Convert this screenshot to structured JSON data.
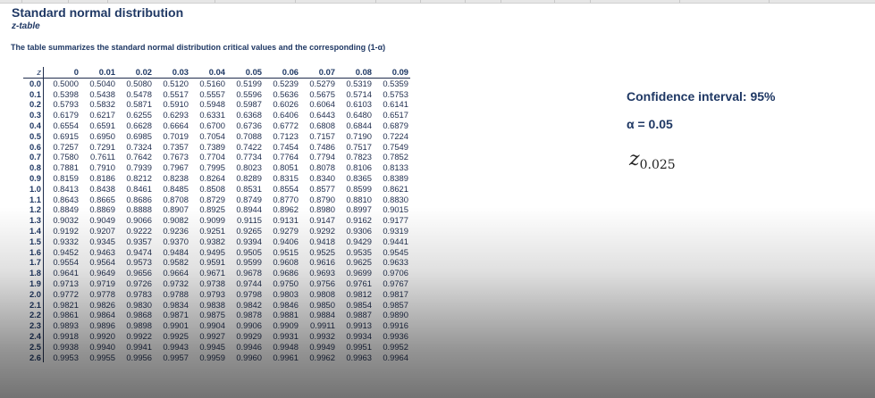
{
  "header": {
    "title": "Standard normal distribution",
    "subtitle": "z-table",
    "description": "The table summarizes the standard normal distribution critical values and the corresponding (1-α)"
  },
  "table": {
    "corner": "z",
    "columns": [
      "0",
      "0.01",
      "0.02",
      "0.03",
      "0.04",
      "0.05",
      "0.06",
      "0.07",
      "0.08",
      "0.09"
    ],
    "rows": [
      {
        "z": "0.0",
        "values": [
          "0.5000",
          "0.5040",
          "0.5080",
          "0.5120",
          "0.5160",
          "0.5199",
          "0.5239",
          "0.5279",
          "0.5319",
          "0.5359"
        ]
      },
      {
        "z": "0.1",
        "values": [
          "0.5398",
          "0.5438",
          "0.5478",
          "0.5517",
          "0.5557",
          "0.5596",
          "0.5636",
          "0.5675",
          "0.5714",
          "0.5753"
        ]
      },
      {
        "z": "0.2",
        "values": [
          "0.5793",
          "0.5832",
          "0.5871",
          "0.5910",
          "0.5948",
          "0.5987",
          "0.6026",
          "0.6064",
          "0.6103",
          "0.6141"
        ]
      },
      {
        "z": "0.3",
        "values": [
          "0.6179",
          "0.6217",
          "0.6255",
          "0.6293",
          "0.6331",
          "0.6368",
          "0.6406",
          "0.6443",
          "0.6480",
          "0.6517"
        ]
      },
      {
        "z": "0.4",
        "values": [
          "0.6554",
          "0.6591",
          "0.6628",
          "0.6664",
          "0.6700",
          "0.6736",
          "0.6772",
          "0.6808",
          "0.6844",
          "0.6879"
        ]
      },
      {
        "z": "0.5",
        "values": [
          "0.6915",
          "0.6950",
          "0.6985",
          "0.7019",
          "0.7054",
          "0.7088",
          "0.7123",
          "0.7157",
          "0.7190",
          "0.7224"
        ]
      },
      {
        "z": "0.6",
        "values": [
          "0.7257",
          "0.7291",
          "0.7324",
          "0.7357",
          "0.7389",
          "0.7422",
          "0.7454",
          "0.7486",
          "0.7517",
          "0.7549"
        ]
      },
      {
        "z": "0.7",
        "values": [
          "0.7580",
          "0.7611",
          "0.7642",
          "0.7673",
          "0.7704",
          "0.7734",
          "0.7764",
          "0.7794",
          "0.7823",
          "0.7852"
        ]
      },
      {
        "z": "0.8",
        "values": [
          "0.7881",
          "0.7910",
          "0.7939",
          "0.7967",
          "0.7995",
          "0.8023",
          "0.8051",
          "0.8078",
          "0.8106",
          "0.8133"
        ]
      },
      {
        "z": "0.9",
        "values": [
          "0.8159",
          "0.8186",
          "0.8212",
          "0.8238",
          "0.8264",
          "0.8289",
          "0.8315",
          "0.8340",
          "0.8365",
          "0.8389"
        ]
      },
      {
        "z": "1.0",
        "values": [
          "0.8413",
          "0.8438",
          "0.8461",
          "0.8485",
          "0.8508",
          "0.8531",
          "0.8554",
          "0.8577",
          "0.8599",
          "0.8621"
        ]
      },
      {
        "z": "1.1",
        "values": [
          "0.8643",
          "0.8665",
          "0.8686",
          "0.8708",
          "0.8729",
          "0.8749",
          "0.8770",
          "0.8790",
          "0.8810",
          "0.8830"
        ]
      },
      {
        "z": "1.2",
        "values": [
          "0.8849",
          "0.8869",
          "0.8888",
          "0.8907",
          "0.8925",
          "0.8944",
          "0.8962",
          "0.8980",
          "0.8997",
          "0.9015"
        ]
      },
      {
        "z": "1.3",
        "values": [
          "0.9032",
          "0.9049",
          "0.9066",
          "0.9082",
          "0.9099",
          "0.9115",
          "0.9131",
          "0.9147",
          "0.9162",
          "0.9177"
        ]
      },
      {
        "z": "1.4",
        "values": [
          "0.9192",
          "0.9207",
          "0.9222",
          "0.9236",
          "0.9251",
          "0.9265",
          "0.9279",
          "0.9292",
          "0.9306",
          "0.9319"
        ]
      },
      {
        "z": "1.5",
        "values": [
          "0.9332",
          "0.9345",
          "0.9357",
          "0.9370",
          "0.9382",
          "0.9394",
          "0.9406",
          "0.9418",
          "0.9429",
          "0.9441"
        ]
      },
      {
        "z": "1.6",
        "values": [
          "0.9452",
          "0.9463",
          "0.9474",
          "0.9484",
          "0.9495",
          "0.9505",
          "0.9515",
          "0.9525",
          "0.9535",
          "0.9545"
        ]
      },
      {
        "z": "1.7",
        "values": [
          "0.9554",
          "0.9564",
          "0.9573",
          "0.9582",
          "0.9591",
          "0.9599",
          "0.9608",
          "0.9616",
          "0.9625",
          "0.9633"
        ]
      },
      {
        "z": "1.8",
        "values": [
          "0.9641",
          "0.9649",
          "0.9656",
          "0.9664",
          "0.9671",
          "0.9678",
          "0.9686",
          "0.9693",
          "0.9699",
          "0.9706"
        ]
      },
      {
        "z": "1.9",
        "values": [
          "0.9713",
          "0.9719",
          "0.9726",
          "0.9732",
          "0.9738",
          "0.9744",
          "0.9750",
          "0.9756",
          "0.9761",
          "0.9767"
        ]
      },
      {
        "z": "2.0",
        "values": [
          "0.9772",
          "0.9778",
          "0.9783",
          "0.9788",
          "0.9793",
          "0.9798",
          "0.9803",
          "0.9808",
          "0.9812",
          "0.9817"
        ]
      },
      {
        "z": "2.1",
        "values": [
          "0.9821",
          "0.9826",
          "0.9830",
          "0.9834",
          "0.9838",
          "0.9842",
          "0.9846",
          "0.9850",
          "0.9854",
          "0.9857"
        ]
      },
      {
        "z": "2.2",
        "values": [
          "0.9861",
          "0.9864",
          "0.9868",
          "0.9871",
          "0.9875",
          "0.9878",
          "0.9881",
          "0.9884",
          "0.9887",
          "0.9890"
        ]
      },
      {
        "z": "2.3",
        "values": [
          "0.9893",
          "0.9896",
          "0.9898",
          "0.9901",
          "0.9904",
          "0.9906",
          "0.9909",
          "0.9911",
          "0.9913",
          "0.9916"
        ]
      },
      {
        "z": "2.4",
        "values": [
          "0.9918",
          "0.9920",
          "0.9922",
          "0.9925",
          "0.9927",
          "0.9929",
          "0.9931",
          "0.9932",
          "0.9934",
          "0.9936"
        ]
      },
      {
        "z": "2.5",
        "values": [
          "0.9938",
          "0.9940",
          "0.9941",
          "0.9943",
          "0.9945",
          "0.9946",
          "0.9948",
          "0.9949",
          "0.9951",
          "0.9952"
        ]
      },
      {
        "z": "2.6",
        "values": [
          "0.9953",
          "0.9955",
          "0.9956",
          "0.9957",
          "0.9959",
          "0.9960",
          "0.9961",
          "0.9962",
          "0.9963",
          "0.9964"
        ]
      }
    ]
  },
  "panel": {
    "confidence": "Confidence interval: 95%",
    "alpha": "α = 0.05",
    "z_symbol": "z",
    "z_subscript": "0.025"
  },
  "colors": {
    "text": "#1f3864",
    "header_bar": "#e6e6e6"
  },
  "icons": {
    "prev": "chevron-left-icon"
  }
}
